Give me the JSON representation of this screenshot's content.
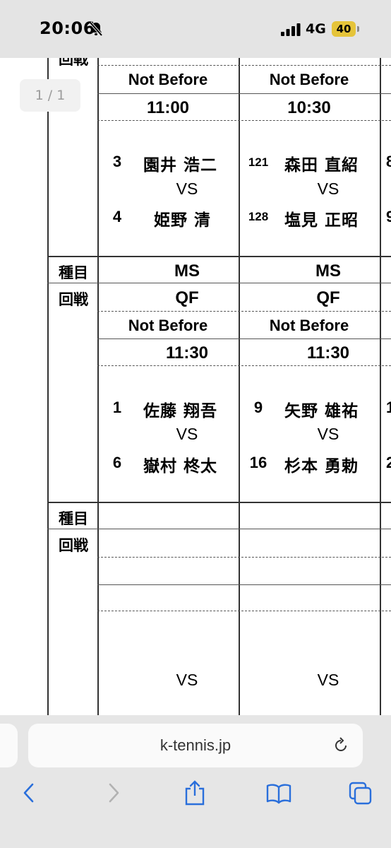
{
  "status_bar": {
    "time": "20:06",
    "network": "4G",
    "battery": "40"
  },
  "document": {
    "page_indicator": "1 / 1",
    "top_partial": {
      "left_label": "回戦",
      "col1": "Not Before",
      "col2": "Not Before"
    },
    "block1": {
      "not_before_col1": "Not Before",
      "not_before_col2": "Not Before",
      "time_col1": "11:00",
      "time_col2": "10:30",
      "col1": {
        "seed_a": "3",
        "player_a": "園井 浩二",
        "vs": "VS",
        "seed_b": "4",
        "player_b": "姫野 清"
      },
      "col2": {
        "seed_a": "121",
        "player_a": "森田 直紹",
        "vs": "VS",
        "seed_b": "128",
        "player_b": "塩見 正昭"
      },
      "col3_partial_a": "8",
      "col3_partial_b": "9"
    },
    "block2": {
      "event_label": "種目",
      "round_label": "回戦",
      "event_col1": "MS",
      "event_col2": "MS",
      "round_col1": "QF",
      "round_col2": "QF",
      "not_before_col1": "Not Before",
      "not_before_col2": "Not Before",
      "time_col1": "11:30",
      "time_col2": "11:30",
      "col1": {
        "seed_a": "1",
        "player_a": "佐藤 翔吾",
        "vs": "VS",
        "seed_b": "6",
        "player_b": "嶽村 柊太"
      },
      "col2": {
        "seed_a": "9",
        "player_a": "矢野 雄祐",
        "vs": "VS",
        "seed_b": "16",
        "player_b": "杉本 勇勅"
      },
      "col3_partial_a": "1",
      "col3_partial_b": "2"
    },
    "block3": {
      "event_label": "種目",
      "round_label": "回戦",
      "vs_col1": "VS",
      "vs_col2": "VS"
    }
  },
  "browser": {
    "url": "k-tennis.jp"
  },
  "icons": [
    "bell-slash-icon",
    "signal-icon",
    "battery-icon",
    "reload-icon",
    "back-icon",
    "forward-icon",
    "share-icon",
    "bookmarks-icon",
    "tabs-icon"
  ]
}
